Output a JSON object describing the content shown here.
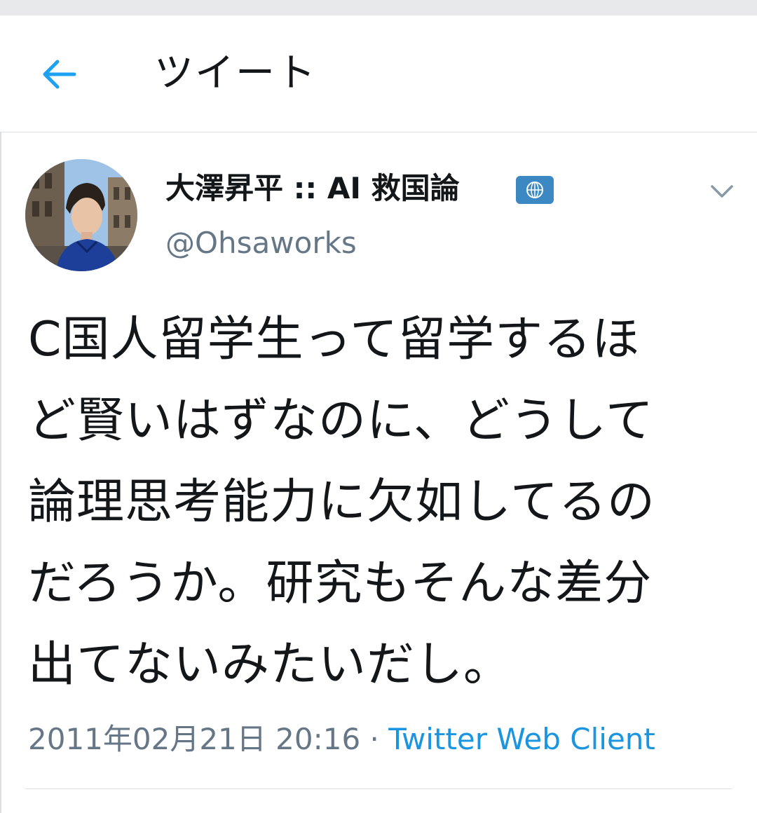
{
  "header": {
    "title": "ツイート",
    "back_icon": "arrow-left-icon",
    "accent": "#1da1f2"
  },
  "tweet": {
    "display_name": "大澤昇平 :: AI 救国論",
    "badge_icon": "un-emblem-icon",
    "handle": "@Ohsaworks",
    "menu_icon": "chevron-down-icon",
    "lines": [
      "C国人留学生って留学するほ",
      "ど賢いはずなのに、どうして",
      "論理思考能力に欠如してるの",
      "だろうか。研究もそんな差分",
      "出てないみたいだし。"
    ],
    "timestamp": "2011年02月21日 20:16",
    "separator": "·",
    "source": "Twitter Web Client"
  }
}
